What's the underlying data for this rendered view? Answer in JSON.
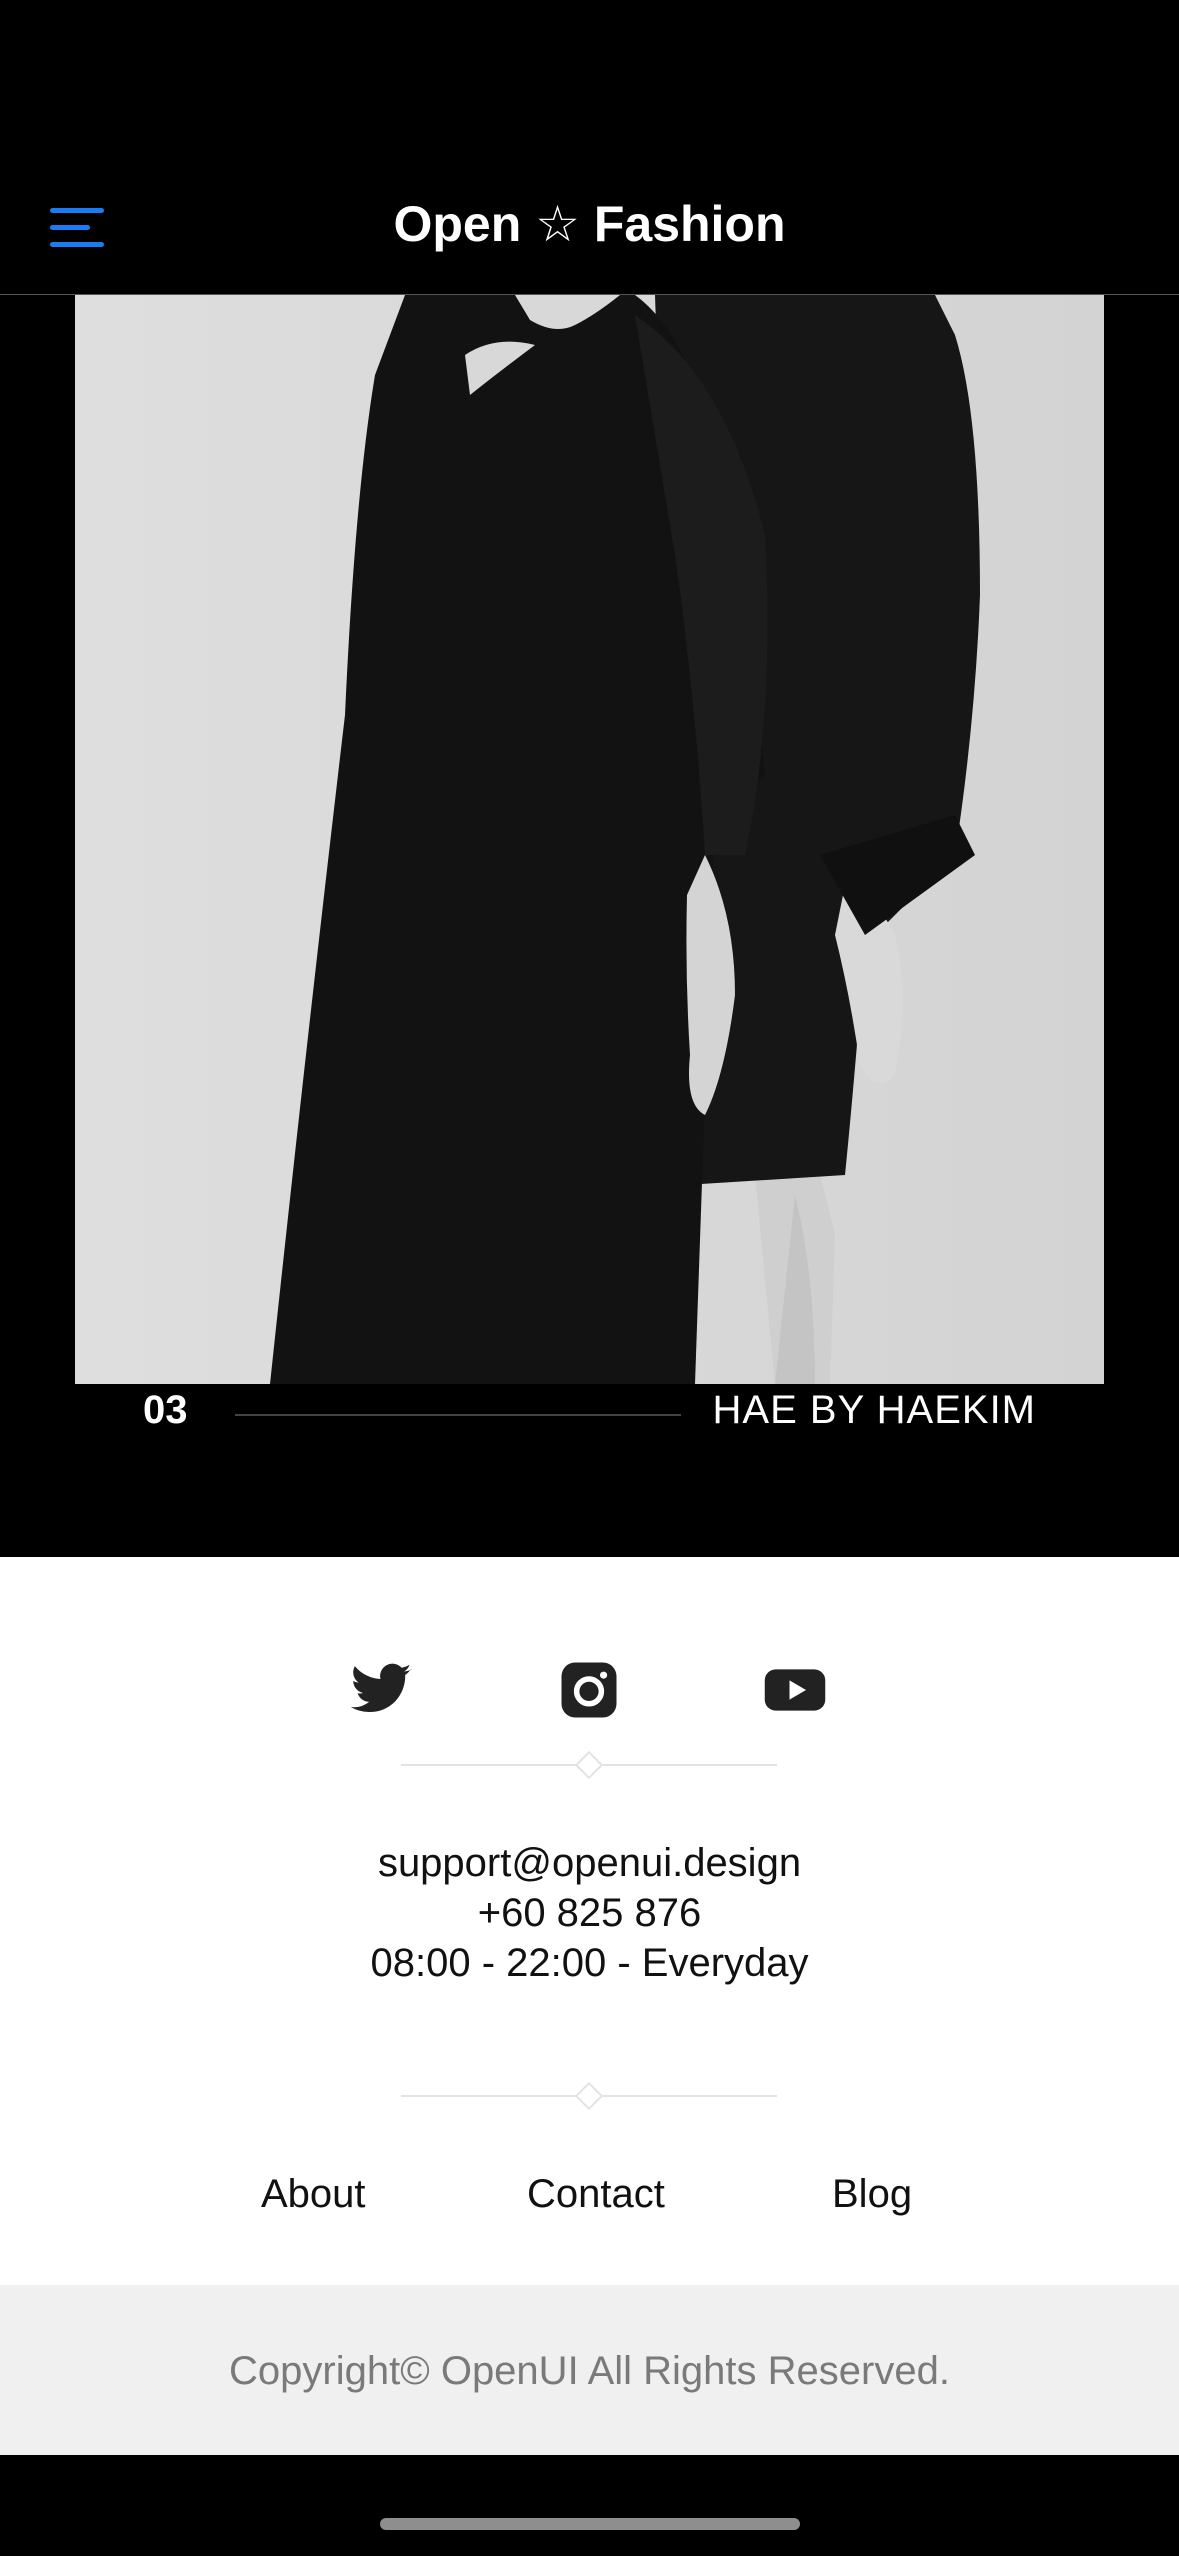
{
  "header": {
    "menu_icon": "hamburger-menu-icon",
    "brand": "Open ☆ Fashion",
    "accent_color": "#1a7cf5"
  },
  "hero": {
    "index": "03",
    "label": "HAE BY HAEKIM"
  },
  "footer": {
    "social": [
      "twitter-icon",
      "instagram-icon",
      "youtube-icon"
    ],
    "email": "support@openui.design",
    "phone": "+60 825 876",
    "hours": "08:00 - 22:00 - Everyday",
    "links": [
      {
        "label": "About"
      },
      {
        "label": "Contact"
      },
      {
        "label": "Blog"
      }
    ],
    "copyright": "Copyright© OpenUI All Rights Reserved."
  }
}
